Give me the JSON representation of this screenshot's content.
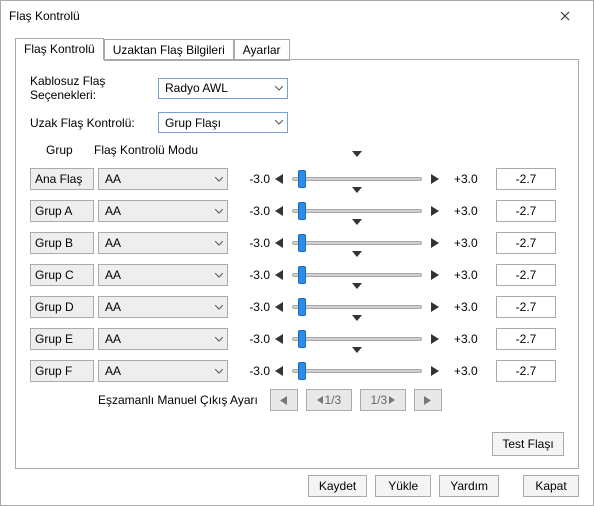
{
  "title": "Flaş Kontrolü",
  "tabs": [
    "Flaş Kontrolü",
    "Uzaktan Flaş Bilgileri",
    "Ayarlar"
  ],
  "wireless_label": "Kablosuz Flaş Seçenekleri:",
  "wireless_value": "Radyo AWL",
  "remote_label": "Uzak Flaş Kontrolü:",
  "remote_value": "Grup Flaşı",
  "col_group": "Grup",
  "col_mode": "Flaş Kontrolü Modu",
  "slider_min": "-3.0",
  "slider_max": "+3.0",
  "groups": [
    {
      "name": "Ana Flaş",
      "mode": "AA",
      "value": "-2.7"
    },
    {
      "name": "Grup A",
      "mode": "AA",
      "value": "-2.7"
    },
    {
      "name": "Grup B",
      "mode": "AA",
      "value": "-2.7"
    },
    {
      "name": "Grup C",
      "mode": "AA",
      "value": "-2.7"
    },
    {
      "name": "Grup D",
      "mode": "AA",
      "value": "-2.7"
    },
    {
      "name": "Grup E",
      "mode": "AA",
      "value": "-2.7"
    },
    {
      "name": "Grup F",
      "mode": "AA",
      "value": "-2.7"
    }
  ],
  "manual_label": "Eşzamanlı Manuel Çıkış Ayarı",
  "page_left": "1/3",
  "page_right": "1/3",
  "test_label": "Test Flaşı",
  "footer": {
    "save": "Kaydet",
    "load": "Yükle",
    "help": "Yardım",
    "close": "Kapat"
  }
}
